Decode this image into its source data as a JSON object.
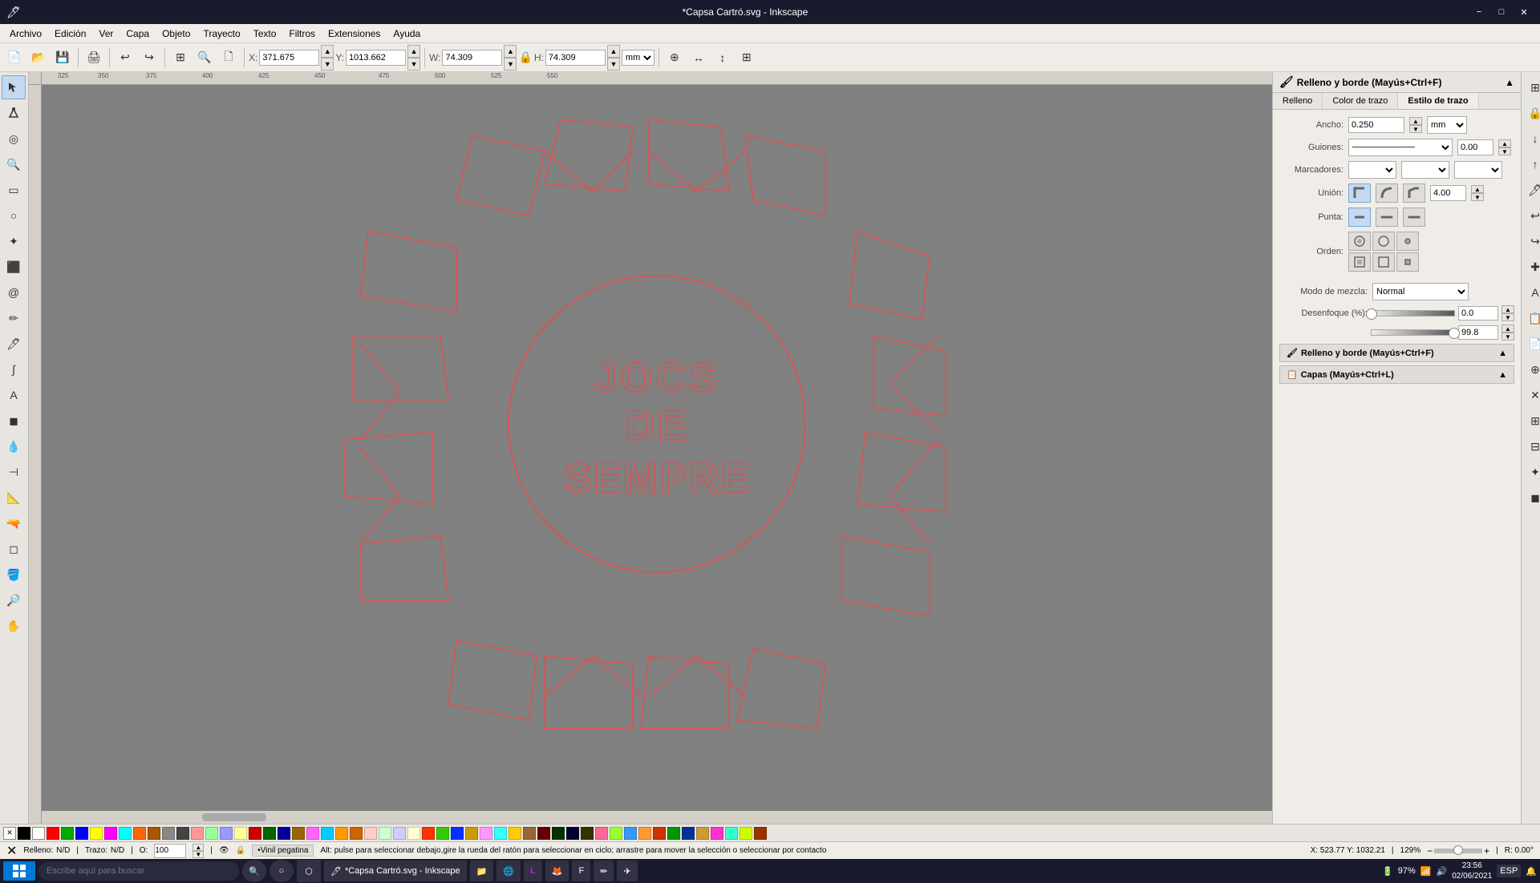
{
  "titlebar": {
    "title": "*Capsa Cartró.svg - Inkscape",
    "minimize": "−",
    "maximize": "□",
    "close": "✕"
  },
  "menubar": {
    "items": [
      "Archivo",
      "Edición",
      "Ver",
      "Capa",
      "Objeto",
      "Trayecto",
      "Texto",
      "Filtros",
      "Extensiones",
      "Ayuda"
    ]
  },
  "toolbar": {
    "buttons": [
      "new",
      "open",
      "save",
      "print",
      "undo",
      "redo",
      "zoom-in",
      "zoom-out",
      "snap"
    ]
  },
  "coordbar": {
    "x_label": "X:",
    "x_value": "371.675",
    "y_label": "Y:",
    "y_value": "1013.662",
    "w_label": "W:",
    "w_value": "74.309",
    "h_label": "H:",
    "h_value": "74.309",
    "unit": "mm"
  },
  "canvas_text": {
    "line1": "JOCS",
    "line2": "DE",
    "line3": "SEMPRE"
  },
  "right_panel": {
    "header": "Relleno y borde (Mayús+Ctrl+F)",
    "tabs": [
      "Relleno",
      "Color de trazo",
      "Estilo de trazo"
    ],
    "active_tab": 2,
    "ancho_label": "Ancho:",
    "ancho_value": "0.250",
    "ancho_unit": "mm",
    "guiones_label": "Guiones:",
    "guiones_value": "0.00",
    "marcadores_label": "Marcadores:",
    "union_label": "Unión:",
    "union_value": "4.00",
    "punta_label": "Punta:",
    "orden_label": "Orden:",
    "modo_mezcla_label": "Modo de mezcla:",
    "modo_mezcla_value": "Normal",
    "desenfoque_label": "Desenfoque (%):",
    "desenfoque_value1": "0.0",
    "desenfoque_value2": "99.8",
    "panel_relleno_label": "Relleno y borde (Mayús+Ctrl+F)",
    "panel_capas_label": "Capas (Mayús+Ctrl+L)"
  },
  "statusbar": {
    "relleno_label": "Relleno:",
    "relleno_value": "N/D",
    "trazo_label": "Trazo:",
    "trazo_value": "N/D",
    "opacity_label": "O:",
    "opacity_value": "100",
    "layer": "Vinil pegatina",
    "hint": "Alt: pulse para seleccionar debajo,gire la rueda del ratón para seleccionar en ciclo; arrastre para mover la selección o seleccionar por contacto",
    "coords": "X: 523.77  Y: 1032.21",
    "zoom": "129%",
    "rotation": "R:  0.00°"
  },
  "colors": {
    "none": "✕",
    "swatches": [
      "#000000",
      "#ffffff",
      "#ff0000",
      "#00aa00",
      "#0000ff",
      "#ffff00",
      "#ff00ff",
      "#00ffff",
      "#ff6600",
      "#aa5500",
      "#888888",
      "#444444",
      "#ff9999",
      "#99ff99",
      "#9999ff",
      "#ffff99",
      "#cc0000",
      "#006600",
      "#000099",
      "#996600",
      "#ff66ff",
      "#00ccff",
      "#ff9900",
      "#cc6600",
      "#ffcccc",
      "#ccffcc",
      "#ccccff",
      "#ffffcc",
      "#ff3300",
      "#33cc00",
      "#0033ff",
      "#cc9900",
      "#ff99ff",
      "#33ffff",
      "#ffcc00",
      "#996633",
      "#660000",
      "#003300",
      "#000033",
      "#333300",
      "#ff6699",
      "#99ff33",
      "#3399ff",
      "#ff9933",
      "#cc3300",
      "#009900",
      "#003399",
      "#cc9933",
      "#ff33cc",
      "#33ffcc",
      "#ccff00",
      "#993300"
    ]
  },
  "taskbar": {
    "search_placeholder": "Escribe aquí para buscar",
    "apps": [
      "Inkscape"
    ],
    "time": "23:56",
    "date": "02/06/2021",
    "battery": "97%",
    "layout": "ESP"
  }
}
